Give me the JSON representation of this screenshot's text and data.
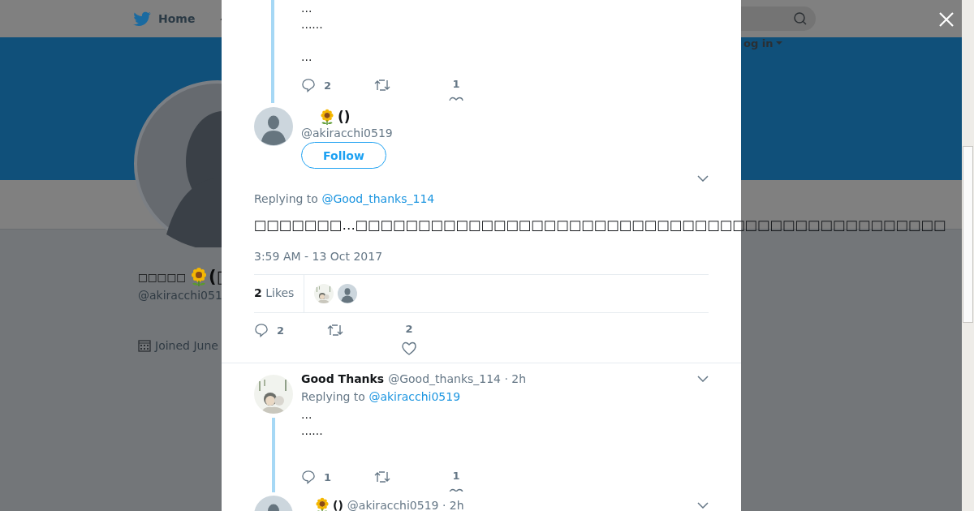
{
  "background_page": {
    "nav": {
      "home_label": "Home",
      "login_label": "og in"
    },
    "profile": {
      "name_before": "□□□□□",
      "name_after": "(□",
      "handle": "@akiracchi051",
      "joined": "Joined June"
    }
  },
  "modal": {
    "parent_tweet": {
      "paragraphs": [
        "...\n......",
        "..."
      ],
      "reply_count": "2",
      "like_count": "1"
    },
    "main_tweet": {
      "author": {
        "name": "()",
        "sunflower": true
      },
      "handle": "@akiracchi0519",
      "follow_label": "Follow",
      "replying_label": "Replying to",
      "replying_to": "@Good_thanks_114",
      "text": "□□□□□□□…□□□□□□□□□□□□□□□□□□□□□□□□□□□□□□□□□□□□□□□□□□□□□□□",
      "time": "3:59 AM - 13 Oct 2017",
      "likes_count": "2",
      "likes_label": "Likes",
      "reply_count": "2",
      "like_count": "2"
    },
    "replies": [
      {
        "kind": "full",
        "author": {
          "name": "Good Thanks",
          "sunflower": false
        },
        "handle_line": "@Good_thanks_114 · 2h",
        "replying_label": "Replying to",
        "replying_to": "@akiracchi0519",
        "text": "...\n......",
        "reply_count": "1",
        "like_count": "1"
      },
      {
        "kind": "cut",
        "author": {
          "name": "()",
          "sunflower": true
        },
        "handle_line": "@akiracchi0519 · 2h"
      }
    ]
  }
}
